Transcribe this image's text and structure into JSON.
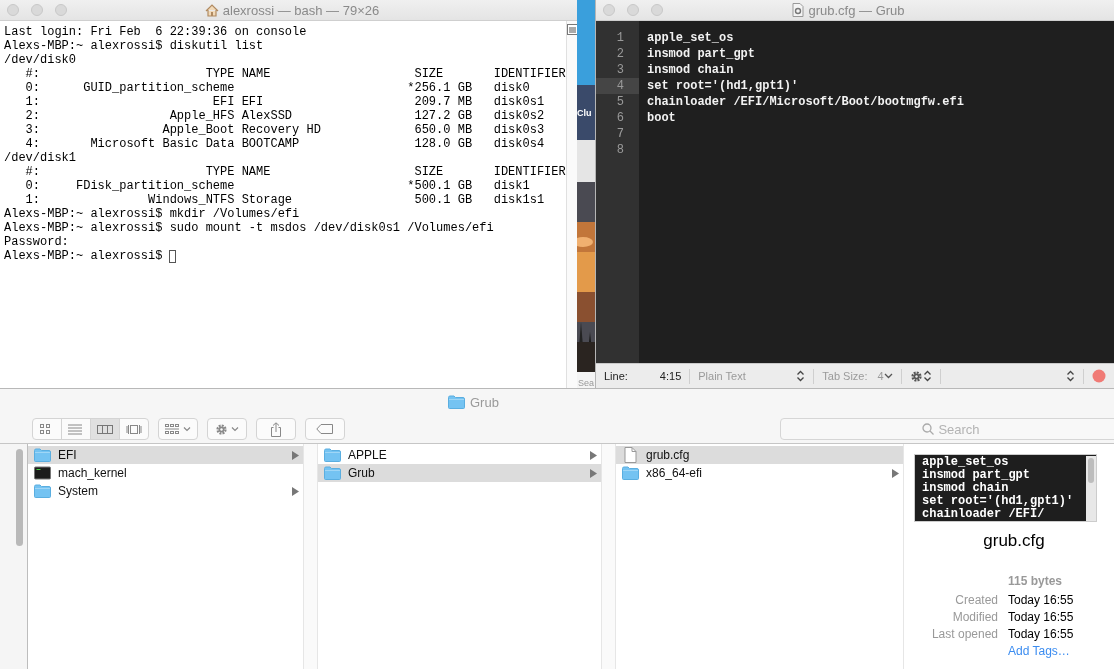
{
  "terminal": {
    "title": "alexrossi — bash — 79×26",
    "lines": [
      "Last login: Fri Feb  6 22:39:36 on console",
      "Alexs-MBP:~ alexrossi$ diskutil list",
      "/dev/disk0",
      "   #:                       TYPE NAME                    SIZE       IDENTIFIER",
      "   0:      GUID_partition_scheme                        *256.1 GB   disk0",
      "   1:                        EFI EFI                     209.7 MB   disk0s1",
      "   2:                  Apple_HFS AlexSSD                 127.2 GB   disk0s2",
      "   3:                 Apple_Boot Recovery HD             650.0 MB   disk0s3",
      "   4:       Microsoft Basic Data BOOTCAMP                128.0 GB   disk0s4",
      "/dev/disk1",
      "   #:                       TYPE NAME                    SIZE       IDENTIFIER",
      "   0:     FDisk_partition_scheme                        *500.1 GB   disk1",
      "   1:               Windows_NTFS Storage                 500.1 GB   disk1s1",
      "Alexs-MBP:~ alexrossi$ mkdir /Volumes/efi",
      "Alexs-MBP:~ alexrossi$ sudo mount -t msdos /dev/disk0s1 /Volumes/efi",
      "Password:",
      "Alexs-MBP:~ alexrossi$"
    ],
    "cursor_visible": true
  },
  "background_window": {
    "top_label": "Clu",
    "search_label": "Sea"
  },
  "editor": {
    "title": "grub.cfg — Grub",
    "lines": [
      {
        "number": "1",
        "text": "apple_set_os",
        "current": false
      },
      {
        "number": "2",
        "text": "insmod part_gpt",
        "current": false
      },
      {
        "number": "3",
        "text": "insmod chain",
        "current": false
      },
      {
        "number": "4",
        "text": "set root='(hd1,gpt1)'",
        "current": true
      },
      {
        "number": "5",
        "text": "chainloader /EFI/Microsoft/Boot/bootmgfw.efi",
        "current": false
      },
      {
        "number": "6",
        "text": "boot",
        "current": false
      },
      {
        "number": "7",
        "current": false
      },
      {
        "number": "8",
        "current": false
      }
    ],
    "status": {
      "line_label": "Line:",
      "position": "4:15",
      "syntax": "Plain Text",
      "tab_label": "Tab Size:",
      "tab_size": "4"
    }
  },
  "finder": {
    "title": "Grub",
    "view_modes": [
      {
        "kind": "icon",
        "selected": false
      },
      {
        "kind": "list",
        "selected": false
      },
      {
        "kind": "column",
        "selected": true
      },
      {
        "kind": "coverflow",
        "selected": false
      }
    ],
    "search": {
      "placeholder": "Search"
    },
    "columns": [
      {
        "items": [
          {
            "name": "EFI",
            "kind": "folder",
            "selected": true,
            "has_children": true
          },
          {
            "name": "mach_kernel",
            "kind": "executable",
            "selected": false,
            "has_children": false
          },
          {
            "name": "System",
            "kind": "folder",
            "selected": false,
            "has_children": true
          }
        ]
      },
      {
        "items": [
          {
            "name": "APPLE",
            "kind": "folder",
            "selected": false,
            "has_children": true
          },
          {
            "name": "Grub",
            "kind": "folder",
            "selected": true,
            "has_children": true
          }
        ]
      },
      {
        "items": [
          {
            "name": "grub.cfg",
            "kind": "document",
            "selected": true,
            "has_children": false
          },
          {
            "name": "x86_64-efi",
            "kind": "folder",
            "selected": false,
            "has_children": true
          }
        ]
      }
    ],
    "preview": {
      "code_lines": [
        "apple_set_os",
        "insmod part_gpt",
        "insmod chain",
        "set root='(hd1,gpt1)'",
        "chainloader /EFI/"
      ],
      "name": "grub.cfg",
      "size": "115 bytes",
      "info": [
        {
          "label": "Created",
          "value": "Today 16:55"
        },
        {
          "label": "Modified",
          "value": "Today 16:55"
        },
        {
          "label": "Last opened",
          "value": "Today 16:55"
        }
      ],
      "tags_link": "Add Tags…"
    }
  }
}
